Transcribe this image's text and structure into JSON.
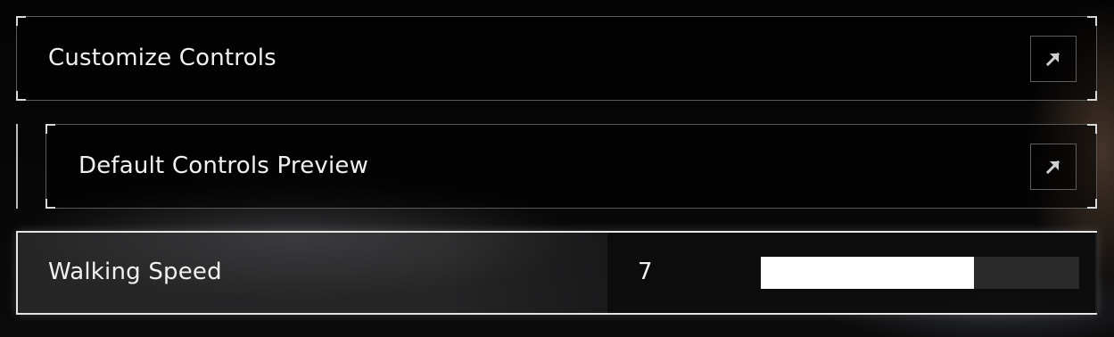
{
  "settings": {
    "rows": [
      {
        "label": "Customize Controls",
        "icon": "external-link-arrow-icon"
      },
      {
        "label": "Default Controls Preview",
        "icon": "external-link-arrow-icon"
      }
    ],
    "walking_speed": {
      "label": "Walking Speed",
      "value": "7",
      "fill_fraction": 0.67
    }
  },
  "colors": {
    "text": "#f1f1f1",
    "border": "#5a5a5a",
    "selected_border": "#e6e6e6",
    "slider_fill": "#ffffff",
    "slider_track": "#2a2a2b"
  }
}
